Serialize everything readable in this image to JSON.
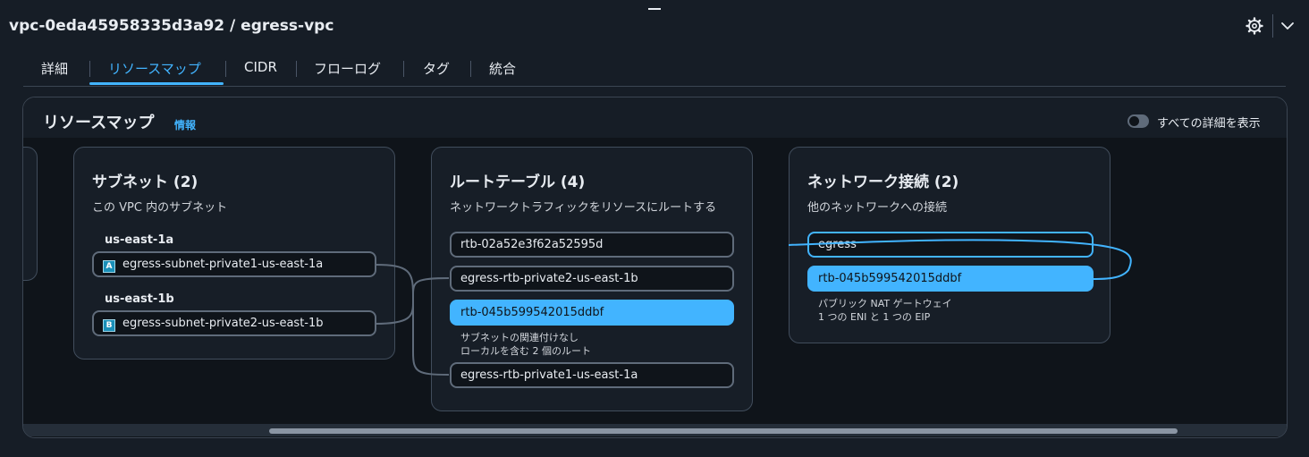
{
  "header": {
    "title": "vpc-0eda45958335d3a92 / egress-vpc",
    "settings_icon": "gear-icon",
    "collapse_icon": "chevron-down-icon"
  },
  "tabs": [
    {
      "label": "詳細",
      "active": false
    },
    {
      "label": "リソースマップ",
      "active": true
    },
    {
      "label": "CIDR",
      "active": false
    },
    {
      "label": "フローログ",
      "active": false
    },
    {
      "label": "タグ",
      "active": false
    },
    {
      "label": "統合",
      "active": false
    }
  ],
  "resource_map": {
    "title": "リソースマップ",
    "info_label": "情報",
    "toggle_label": "すべての詳細を表示",
    "toggle_on": false,
    "subnets": {
      "title": "サブネット (2)",
      "subtitle": "この VPC 内のサブネット",
      "groups": [
        {
          "az": "us-east-1a",
          "badge": "A",
          "subnet": "egress-subnet-private1-us-east-1a"
        },
        {
          "az": "us-east-1b",
          "badge": "B",
          "subnet": "egress-subnet-private2-us-east-1b"
        }
      ]
    },
    "route_tables": {
      "title": "ルートテーブル (4)",
      "subtitle": "ネットワークトラフィックをリソースにルートする",
      "items": [
        {
          "label": "rtb-02a52e3f62a52595d",
          "selected": false
        },
        {
          "label": "egress-rtb-private2-us-east-1b",
          "selected": false
        },
        {
          "label": "rtb-045b599542015ddbf",
          "selected": true
        },
        {
          "label": "egress-rtb-private1-us-east-1a",
          "selected": false
        }
      ],
      "selected_note_1": "サブネットの関連付けなし",
      "selected_note_2": "ローカルを含む 2 個のルート"
    },
    "network_connections": {
      "title": "ネットワーク接続 (2)",
      "subtitle": "他のネットワークへの接続",
      "items": [
        {
          "label": "egress",
          "selected": false
        },
        {
          "label": "rtb-045b599542015ddbf",
          "selected": true
        }
      ],
      "selected_note_1": "パブリック NAT ゲートウェイ",
      "selected_note_2": "1 つの ENI と 1 つの EIP"
    }
  },
  "colors": {
    "accent": "#42b4ff",
    "background": "#161d26",
    "canvas": "#0f141a",
    "card": "#171e27",
    "border": "#414d5c"
  }
}
